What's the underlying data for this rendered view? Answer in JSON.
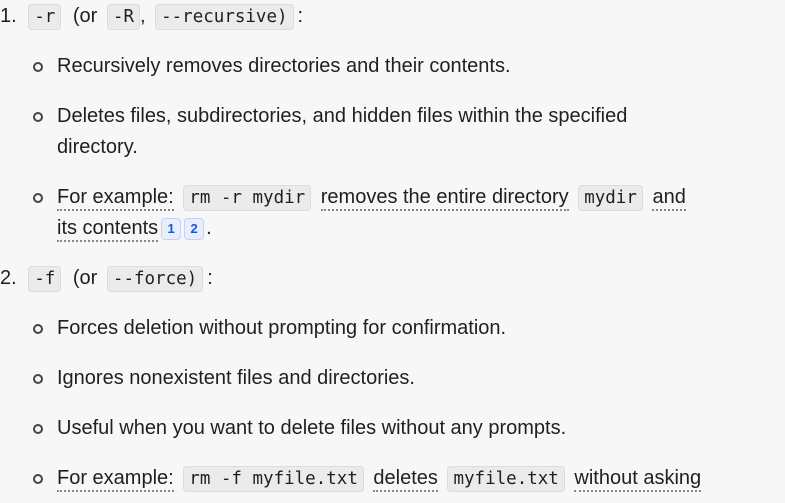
{
  "list": {
    "item1": {
      "number": "1.",
      "flag_short": "-r",
      "open_paren": "(or",
      "flag_alt": "-R",
      "comma": ",",
      "flag_long": "--recursive)",
      "colon": ":",
      "bullets": {
        "b1": "Recursively removes directories and their contents.",
        "b2_line1": "Deletes files, subdirectories, and hidden files within the specified",
        "b2_line2": "directory.",
        "b3_prefix": "For example:",
        "b3_code1": "rm -r mydir",
        "b3_mid": "removes the entire directory",
        "b3_code2": "mydir",
        "b3_and": "and",
        "b3_line2": "its contents",
        "citation1": "1",
        "citation2": "2",
        "b3_end": "."
      }
    },
    "item2": {
      "number": "2.",
      "flag_short": "-f",
      "open_paren": "(or",
      "flag_long": "--force)",
      "colon": ":",
      "bullets": {
        "b1": "Forces deletion without prompting for confirmation.",
        "b2": "Ignores nonexistent files and directories.",
        "b3": "Useful when you want to delete files without any prompts.",
        "b4_prefix": "For example:",
        "b4_code1": "rm -f myfile.txt",
        "b4_mid": "deletes",
        "b4_code2": "myfile.txt",
        "b4_end": "without asking"
      }
    }
  }
}
